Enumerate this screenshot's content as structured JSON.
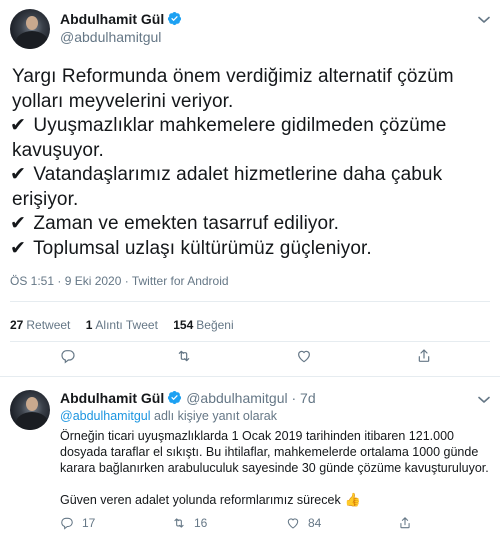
{
  "main_tweet": {
    "display_name": "Abdulhamit Gül",
    "handle": "@abdulhamitgul",
    "lines": [
      {
        "check": "",
        "text": "Yargı Reformunda önem verdiğimiz alternatif çözüm"
      },
      {
        "check": "",
        "text": "yolları meyvelerini veriyor."
      },
      {
        "check": "✔",
        "text": "Uyuşmazlıklar mahkemelere gidilmeden çözüme"
      },
      {
        "check": "",
        "text": "kavuşuyor."
      },
      {
        "check": "✔",
        "text": "Vatandaşlarımız adalet hizmetlerine daha çabuk"
      },
      {
        "check": "",
        "text": "erişiyor."
      },
      {
        "check": "✔",
        "text": "Zaman ve emekten tasarruf ediliyor."
      },
      {
        "check": "✔",
        "text": "Toplumsal uzlaşı kültürümüz güçleniyor."
      }
    ],
    "meta": "ÖS 1:51 · 9 Eki 2020 · Twitter for Android",
    "stats": {
      "retweets_count": "27",
      "retweets_label": "Retweet",
      "quotes_count": "1",
      "quotes_label": "Alıntı Tweet",
      "likes_count": "154",
      "likes_label": "Beğeni"
    }
  },
  "reply_tweet": {
    "display_name": "Abdulhamit Gül",
    "handle": "@abdulhamitgul · 7d",
    "replying_mention": "@abdulhamitgul",
    "replying_suffix": " adlı kişiye yanıt olarak",
    "body_lines": [
      "Örneğin ticari uyuşmazlıklarda 1 Ocak 2019 tarihinden itibaren 121.000",
      "dosyada taraflar el sıkıştı. Bu ihtilaflar, mahkemelerde ortalama 1000 günde",
      "karara bağlanırken arabuluculuk sayesinde 30 günde çözüme kavuşturuluyor."
    ],
    "closing_line": "Güven veren adalet yolunda reformlarımız sürecek",
    "reply_count": "17",
    "retweet_count": "16",
    "like_count": "84"
  },
  "colors": {
    "verified": "#1da1f2",
    "secondary_text": "#657786",
    "link": "#1b95e0",
    "divider": "#e6ecf0"
  },
  "icons": [
    "verified-badge-icon",
    "chevron-down-icon",
    "reply-icon",
    "retweet-icon",
    "like-icon",
    "share-icon",
    "thumbs-up-emoji"
  ]
}
